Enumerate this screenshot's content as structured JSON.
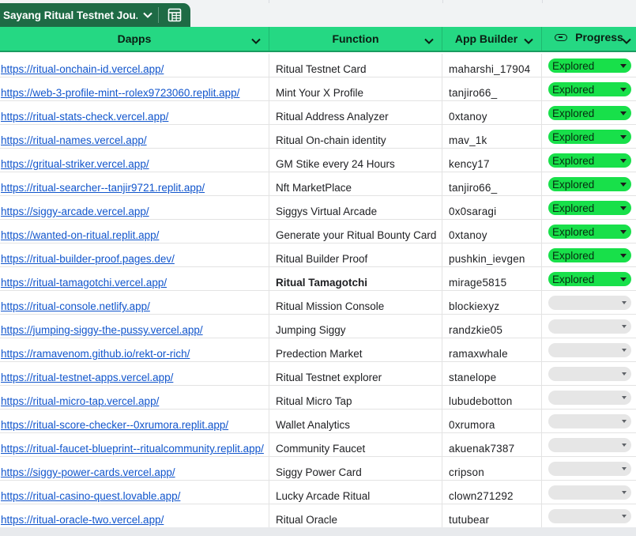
{
  "sheet_tab": {
    "label": "Sayang Ritual Testnet Jou..."
  },
  "header": {
    "dapps": "Dapps",
    "function": "Function",
    "builder": "App Builder",
    "progress": "Progress"
  },
  "rows": [
    {
      "link": "https://ritual-onchain-id.vercel.app/",
      "function": "Ritual Testnet Card",
      "builder": "maharshi_17904",
      "progress": "Explored"
    },
    {
      "link": "https://web-3-profile-mint--rolex9723060.replit.app/",
      "function": "Mint Your X Profile",
      "builder": "tanjiro66_",
      "progress": "Explored"
    },
    {
      "link": "https://ritual-stats-check.vercel.app/",
      "function": "Ritual Address Analyzer",
      "builder": "0xtanoy",
      "progress": "Explored"
    },
    {
      "link": "https://ritual-names.vercel.app/",
      "function": "Ritual On-chain identity",
      "builder": "mav_1k",
      "progress": "Explored"
    },
    {
      "link": "https://gritual-striker.vercel.app/",
      "function": "GM Stike every 24 Hours",
      "builder": "kency17",
      "progress": "Explored"
    },
    {
      "link": "https://ritual-searcher--tanjir9721.replit.app/",
      "function": "Nft MarketPlace",
      "builder": "tanjiro66_",
      "progress": "Explored"
    },
    {
      "link": "https://siggy-arcade.vercel.app/",
      "function": "Siggys Virtual Arcade",
      "builder": "0x0saragi",
      "progress": "Explored"
    },
    {
      "link": "https://wanted-on-ritual.replit.app/",
      "function": "Generate your Ritual Bounty Card",
      "builder": "0xtanoy",
      "progress": "Explored"
    },
    {
      "link": "https://ritual-builder-proof.pages.dev/",
      "function": "Ritual Builder Proof",
      "builder": "pushkin_ievgen",
      "progress": "Explored"
    },
    {
      "link": "https://ritual-tamagotchi.vercel.app/",
      "function": "Ritual Tamagotchi",
      "builder": "mirage5815",
      "progress": "Explored",
      "bold": true
    },
    {
      "link": "https://ritual-console.netlify.app/",
      "function": "Ritual Mission Console",
      "builder": "blockiexyz",
      "progress": ""
    },
    {
      "link": "https://jumping-siggy-the-pussy.vercel.app/",
      "function": "Jumping Siggy",
      "builder": "randzkie05",
      "progress": ""
    },
    {
      "link": "https://ramavenom.github.io/rekt-or-rich/",
      "function": "Predection Market",
      "builder": "ramaxwhale",
      "progress": ""
    },
    {
      "link": "https://ritual-testnet-apps.vercel.app/",
      "function": "Ritual Testnet explorer",
      "builder": "stanelope",
      "progress": ""
    },
    {
      "link": "https://ritual-micro-tap.vercel.app/",
      "function": "Ritual Micro Tap",
      "builder": "lubudebotton",
      "progress": ""
    },
    {
      "link": "https://ritual-score-checker--0xrumora.replit.app/",
      "function": "Wallet Analytics",
      "builder": "0xrumora",
      "progress": ""
    },
    {
      "link": "https://ritual-faucet-blueprint--ritualcommunity.replit.app/",
      "function": "Community Faucet",
      "builder": "akuenak7387",
      "progress": ""
    },
    {
      "link": "https://siggy-power-cards.vercel.app/",
      "function": "Siggy Power Card",
      "builder": "cripson",
      "progress": ""
    },
    {
      "link": "https://ritual-casino-quest.lovable.app/",
      "function": "Lucky Arcade Ritual",
      "builder": "clown271292",
      "progress": ""
    },
    {
      "link": "https://ritual-oracle-two.vercel.app/",
      "function": "Ritual Oracle",
      "builder": "tutubear",
      "progress": ""
    }
  ],
  "colors": {
    "tab_bg": "#1e6b45",
    "header_bg": "#25d883",
    "explored_chip": "#18e04a",
    "empty_chip": "#e6e6e6",
    "link": "#1155cc"
  },
  "icons": {
    "tab_caret": "chevron-down-icon",
    "tab_sheet": "spreadsheet-icon",
    "header_caret": "chevron-down-icon",
    "progress_chip": "chip-icon",
    "dropdown": "dropdown-triangle-icon"
  }
}
